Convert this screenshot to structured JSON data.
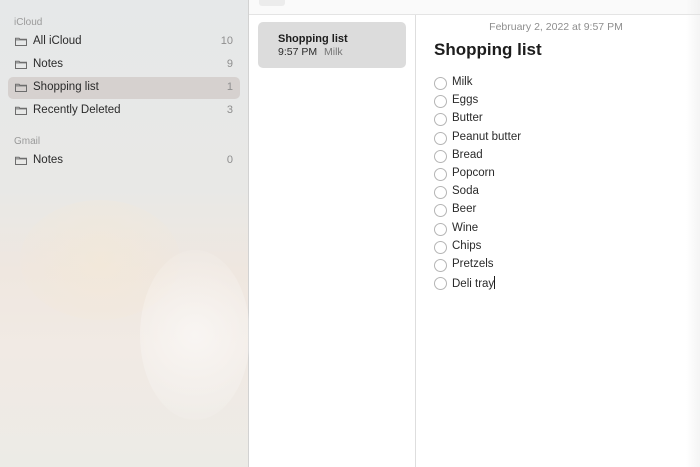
{
  "sidebar": {
    "icloud_header": "iCloud",
    "icloud_folders": [
      {
        "label": "All iCloud",
        "count": "10"
      },
      {
        "label": "Notes",
        "count": "9"
      },
      {
        "label": "Shopping list",
        "count": "1"
      },
      {
        "label": "Recently Deleted",
        "count": "3"
      }
    ],
    "gmail_header": "Gmail",
    "gmail_folders": [
      {
        "label": "Notes",
        "count": "0"
      }
    ]
  },
  "note_list": {
    "items": [
      {
        "title": "Shopping list",
        "time": "9:57 PM",
        "preview": "Milk"
      }
    ]
  },
  "editor": {
    "date": "February 2, 2022 at 9:57 PM",
    "title": "Shopping list",
    "checklist": [
      "Milk",
      "Eggs",
      "Butter",
      "Peanut butter",
      "Bread",
      "Popcorn",
      "Soda",
      "Beer",
      "Wine",
      "Chips",
      "Pretzels",
      "Deli tray"
    ]
  },
  "colors": {
    "selected_folder": "#d6d1cf",
    "selected_note": "#dcdcdc"
  },
  "icons": {
    "folder": "folder-icon",
    "checkbox": "checkbox-circle-icon"
  }
}
